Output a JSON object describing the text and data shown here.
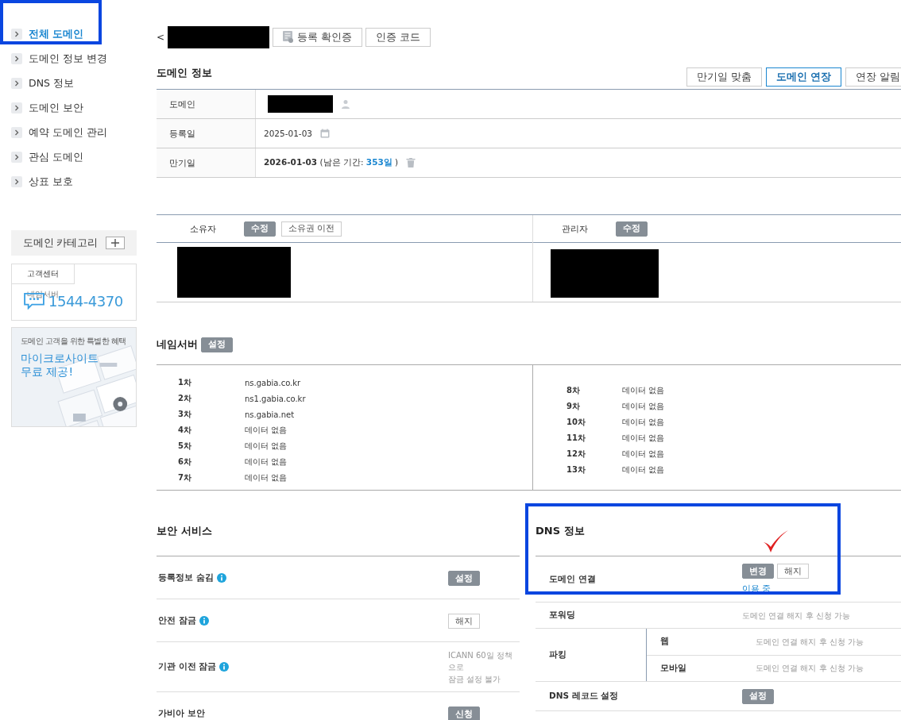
{
  "sidebar": {
    "items": [
      {
        "label": "전체 도메인",
        "selected": true
      },
      {
        "label": "도메인 정보 변경",
        "selected": false
      },
      {
        "label": "DNS 정보",
        "selected": false
      },
      {
        "label": "도메인 보안",
        "selected": false
      },
      {
        "label": "예약 도메인 관리",
        "selected": false
      },
      {
        "label": "관심 도메인",
        "selected": false
      },
      {
        "label": "상표 보호",
        "selected": false
      }
    ],
    "category": {
      "label": "도메인 카테고리"
    },
    "support": {
      "tab": "고객센터",
      "overlap_label": "네임서버",
      "phone": "1544-4370"
    },
    "banner": {
      "caption": "도메인 고객을 위한 특별한 혜택",
      "headline_1": "마이크로사이트",
      "headline_2": "무료 제공!"
    }
  },
  "topbar": {
    "back": "<",
    "buttons": [
      "등록 확인증",
      "인증 코드"
    ]
  },
  "domain_info": {
    "title": "도메인 정보",
    "actions": [
      {
        "label": "만기일 맞춤",
        "selected": false
      },
      {
        "label": "도메인 연장",
        "selected": true
      },
      {
        "label": "연장 알림",
        "selected": false
      }
    ],
    "rows": [
      {
        "kind": "domain",
        "label": "도메인"
      },
      {
        "kind": "date",
        "label": "등록일",
        "value": "2025-01-03"
      },
      {
        "kind": "expiry",
        "label": "만기일",
        "value": "2026-01-03",
        "remaining_prefix": "(남은 기간:",
        "remaining": "353일",
        "remaining_suffix": ")"
      }
    ]
  },
  "contacts": [
    {
      "label": "소유자",
      "buttons": [
        {
          "label": "수정",
          "kind": "filled"
        },
        {
          "label": "소유권 이전",
          "kind": "outline"
        }
      ]
    },
    {
      "label": "관리자",
      "buttons": [
        {
          "label": "수정",
          "kind": "filled"
        }
      ]
    }
  ],
  "nameservers": {
    "title": "네임서버",
    "button": "설정",
    "left": [
      {
        "rank": "1차",
        "value": "ns.gabia.co.kr"
      },
      {
        "rank": "2차",
        "value": "ns1.gabia.co.kr"
      },
      {
        "rank": "3차",
        "value": "ns.gabia.net"
      },
      {
        "rank": "4차",
        "value": "데이터 없음"
      },
      {
        "rank": "5차",
        "value": "데이터 없음"
      },
      {
        "rank": "6차",
        "value": "데이터 없음"
      },
      {
        "rank": "7차",
        "value": "데이터 없음"
      }
    ],
    "right": [
      {
        "rank": "8차",
        "value": "데이터 없음"
      },
      {
        "rank": "9차",
        "value": "데이터 없음"
      },
      {
        "rank": "10차",
        "value": "데이터 없음"
      },
      {
        "rank": "11차",
        "value": "데이터 없음"
      },
      {
        "rank": "12차",
        "value": "데이터 없음"
      },
      {
        "rank": "13차",
        "value": "데이터 없음"
      }
    ]
  },
  "security": {
    "title": "보안 서비스",
    "rows": [
      {
        "label": "등록정보 숨김",
        "info": true,
        "kind": "button",
        "button": {
          "label": "설정",
          "kind": "filled"
        }
      },
      {
        "label": "안전 잠금",
        "info": true,
        "kind": "button",
        "button": {
          "label": "해지",
          "kind": "outline"
        }
      },
      {
        "label": "기관 이전 잠금",
        "info": true,
        "kind": "note",
        "note_lines": [
          "ICANN 60일 정책",
          "으로",
          "잠금 설정 불가"
        ]
      },
      {
        "label": "가비아 보안",
        "info": false,
        "kind": "button",
        "button": {
          "label": "신청",
          "kind": "filled"
        }
      }
    ]
  },
  "dns": {
    "title": "DNS 정보",
    "rows": [
      {
        "kind": "buttons",
        "label": "도메인 연결",
        "buttons": [
          {
            "label": "변경",
            "kind": "filled"
          },
          {
            "label": "해지",
            "kind": "outline"
          }
        ],
        "status": "이용 중"
      },
      {
        "kind": "note",
        "label": "포워딩",
        "note": "도메인 연결 해지 후 신청 가능"
      },
      {
        "kind": "group",
        "label": "파킹",
        "children": [
          {
            "label": "웹",
            "note": "도메인 연결 해지 후 신청 가능"
          },
          {
            "label": "모바일",
            "note": "도메인 연결 해지 후 신청 가능"
          }
        ]
      },
      {
        "kind": "button",
        "label": "DNS 레코드 설정",
        "buttons": [
          {
            "label": "설정",
            "kind": "filled"
          }
        ]
      }
    ]
  }
}
